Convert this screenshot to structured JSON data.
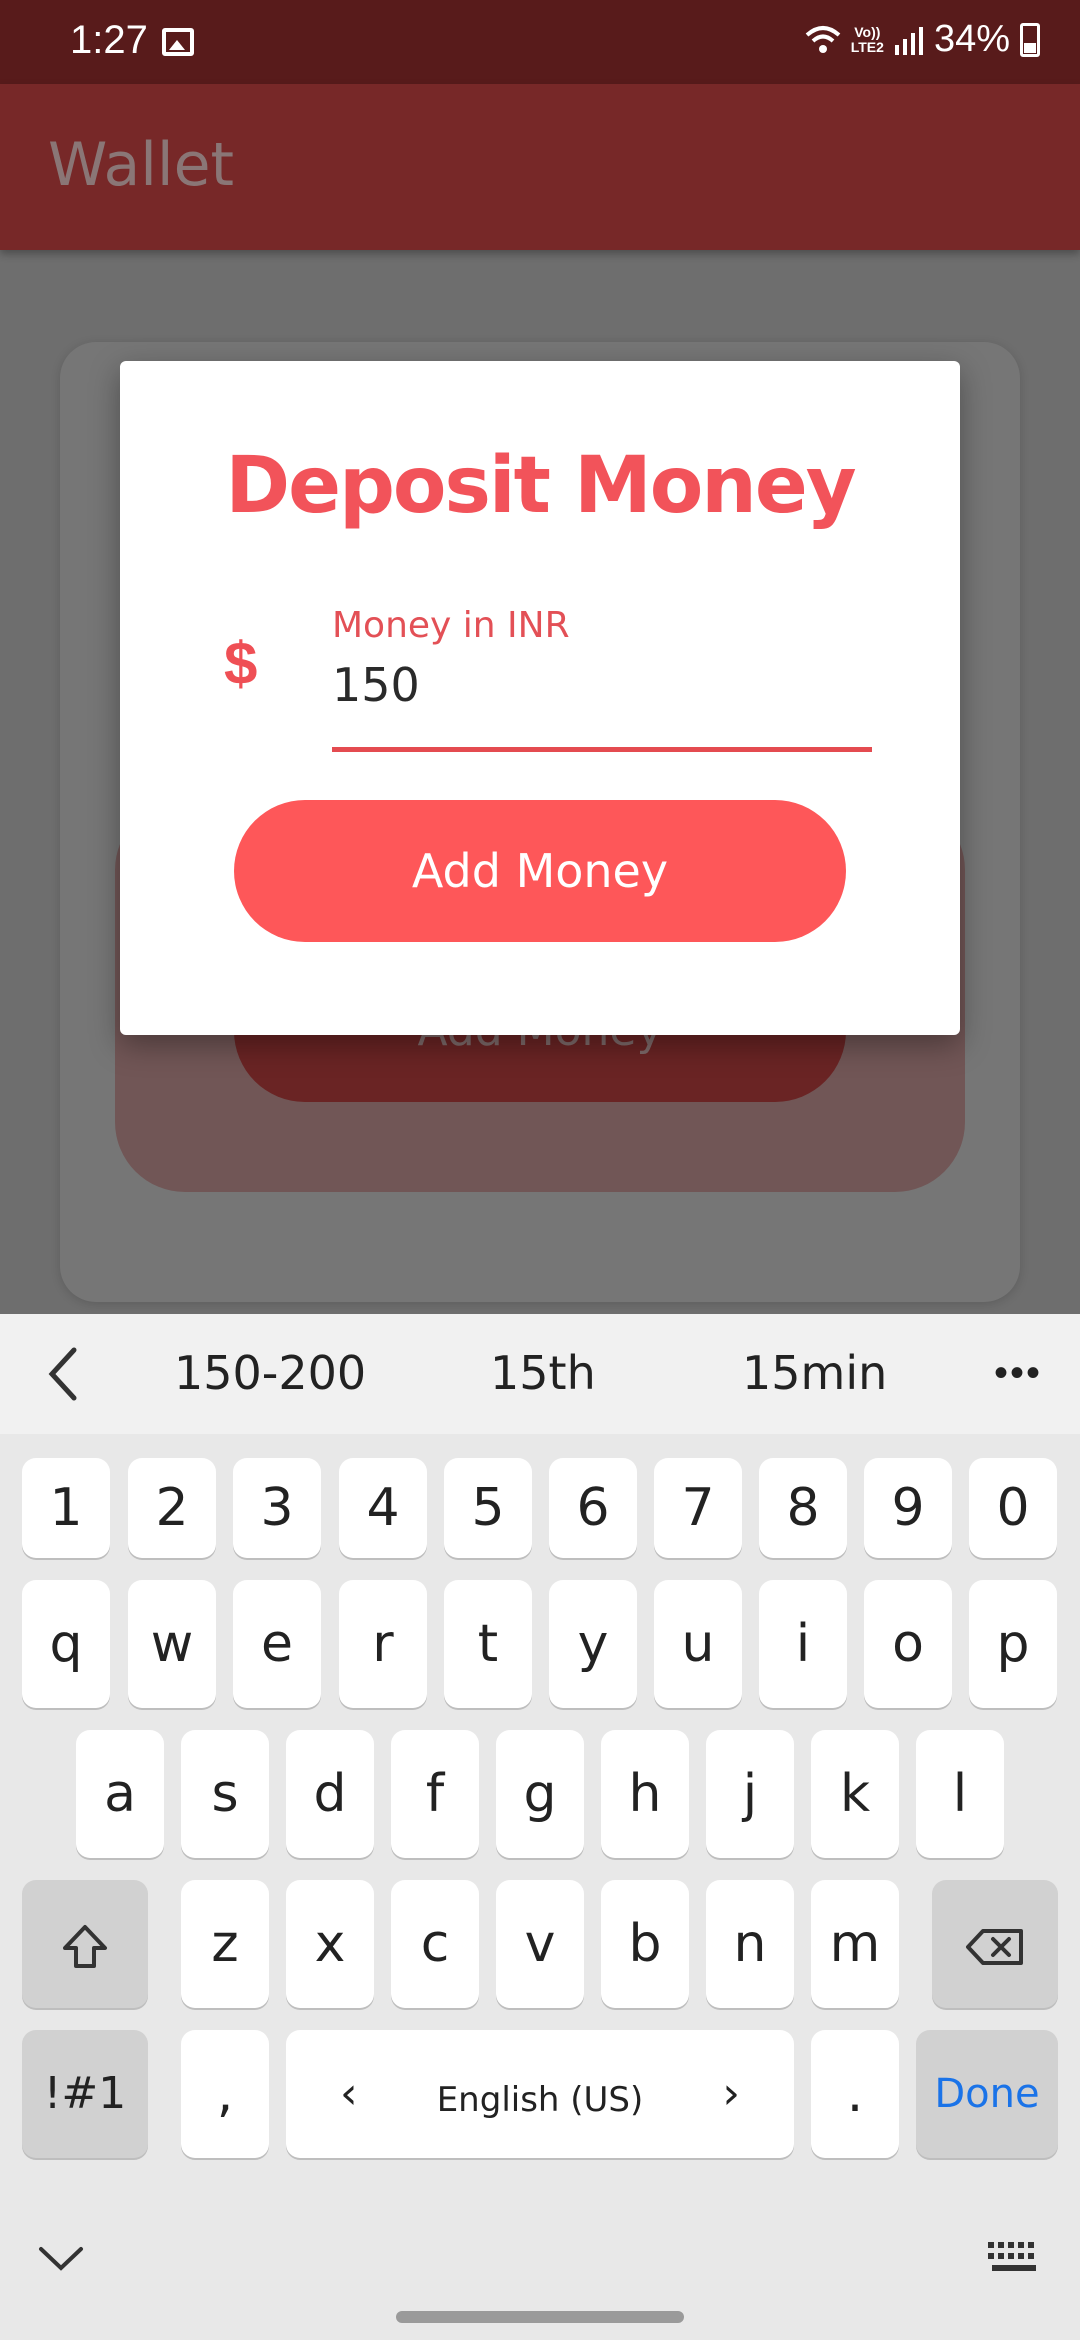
{
  "status_bar": {
    "time": "1:27",
    "volte": "Vo))",
    "lte": "LTE2",
    "battery": "34%"
  },
  "app_bar": {
    "title": "Wallet"
  },
  "background": {
    "button_label": "Add Money"
  },
  "dialog": {
    "title": "Deposit Money",
    "field_label": "Money in INR",
    "field_value": "150",
    "currency_symbol": "$",
    "button_label": "Add Money"
  },
  "keyboard": {
    "suggestions": [
      "150-200",
      "15th",
      "15min"
    ],
    "more": "•••",
    "number_row": [
      "1",
      "2",
      "3",
      "4",
      "5",
      "6",
      "7",
      "8",
      "9",
      "0"
    ],
    "row1": [
      "q",
      "w",
      "e",
      "r",
      "t",
      "y",
      "u",
      "i",
      "o",
      "p"
    ],
    "row2": [
      "a",
      "s",
      "d",
      "f",
      "g",
      "h",
      "j",
      "k",
      "l"
    ],
    "row3": [
      "z",
      "x",
      "c",
      "v",
      "b",
      "n",
      "m"
    ],
    "symbols_label": "!#1",
    "comma": ",",
    "period": ".",
    "language": "English (US)",
    "lang_prev": "‹",
    "lang_next": "›",
    "done_label": "Done"
  },
  "colors": {
    "accent": "#fe5759",
    "app_bar": "#772828",
    "status_bar": "#581b1b",
    "done": "#1a73e8"
  }
}
